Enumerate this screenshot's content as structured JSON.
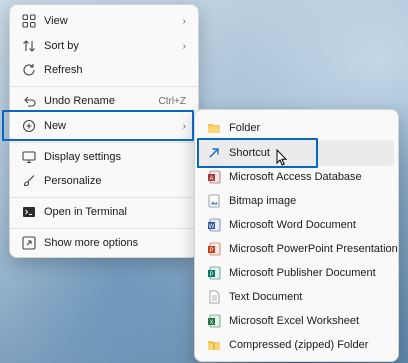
{
  "context_menu": {
    "items": [
      {
        "label": "View",
        "icon": "view-grid-icon"
      },
      {
        "label": "Sort by",
        "icon": "sort-icon"
      },
      {
        "label": "Refresh",
        "icon": "refresh-icon"
      },
      {
        "label": "Undo Rename",
        "icon": "undo-icon",
        "shortcut": "Ctrl+Z"
      },
      {
        "label": "New",
        "icon": "add-circle-icon"
      },
      {
        "label": "Display settings",
        "icon": "display-icon"
      },
      {
        "label": "Personalize",
        "icon": "brush-icon"
      },
      {
        "label": "Open in Terminal",
        "icon": "terminal-icon"
      },
      {
        "label": "Show more options",
        "icon": "expand-icon"
      }
    ]
  },
  "new_submenu": {
    "items": [
      {
        "label": "Folder",
        "icon": "folder-icon"
      },
      {
        "label": "Shortcut",
        "icon": "shortcut-arrow-icon"
      },
      {
        "label": "Microsoft Access Database",
        "icon": "access-icon"
      },
      {
        "label": "Bitmap image",
        "icon": "bitmap-icon"
      },
      {
        "label": "Microsoft Word Document",
        "icon": "word-icon"
      },
      {
        "label": "Microsoft PowerPoint Presentation",
        "icon": "powerpoint-icon"
      },
      {
        "label": "Microsoft Publisher Document",
        "icon": "publisher-icon"
      },
      {
        "label": "Text Document",
        "icon": "text-document-icon"
      },
      {
        "label": "Microsoft Excel Worksheet",
        "icon": "excel-icon"
      },
      {
        "label": "Compressed (zipped) Folder",
        "icon": "zip-folder-icon"
      }
    ]
  },
  "colors": {
    "focus": "#0a66c2",
    "menu_bg": "#f9f9f9"
  }
}
